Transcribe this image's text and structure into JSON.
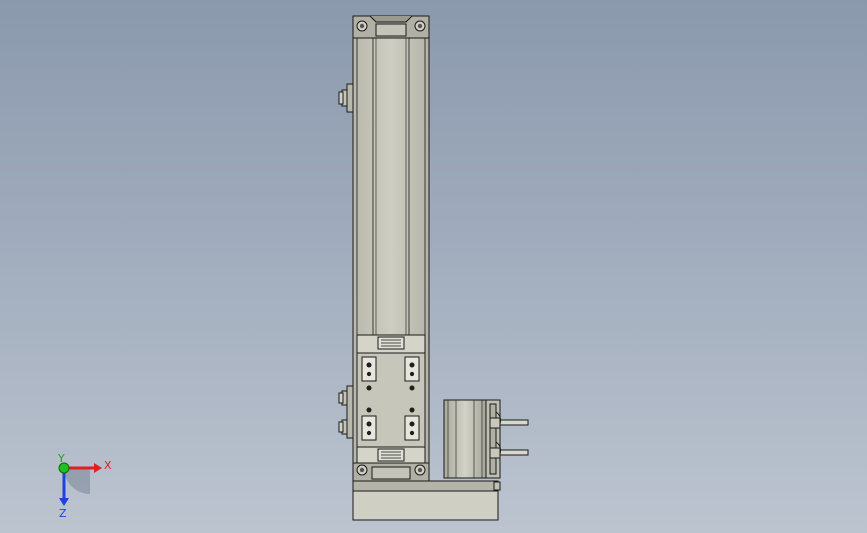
{
  "viewport": {
    "background_top": "#8b99ad",
    "background_bottom": "#bcc4cf"
  },
  "model": {
    "name": "linear-actuator-with-motor",
    "body_color": "#c8c8bc",
    "edge_color": "#1a1a1a"
  },
  "triad": {
    "x_label": "X",
    "y_label": "Y",
    "z_label": "Z",
    "x_color": "#e02020",
    "y_color": "#20c020",
    "z_color": "#2040e0"
  }
}
